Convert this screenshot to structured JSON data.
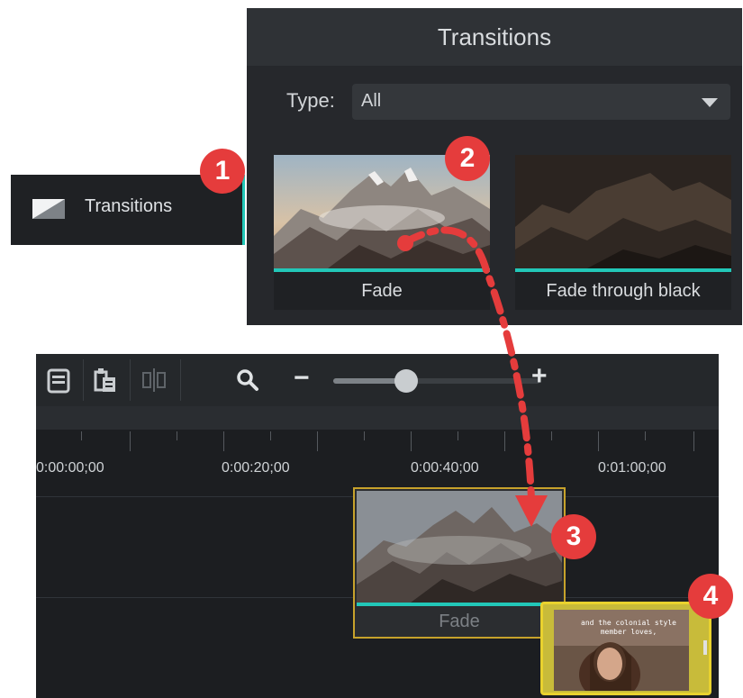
{
  "sidebar": {
    "label": "Transitions",
    "icon": "transitions-icon"
  },
  "panel": {
    "title": "Transitions",
    "type_label": "Type:",
    "type_value": "All",
    "tiles": [
      {
        "label": "Fade"
      },
      {
        "label": "Fade through black"
      }
    ]
  },
  "timeline": {
    "toolbar": {
      "zoom_minus": "−",
      "zoom_plus": "+",
      "zoom_level": 0.35
    },
    "ruler_labels": [
      "0:00:00;00",
      "0:00:20;00",
      "0:00:40;00",
      "0:01:00;00"
    ],
    "clip_fade_label": "Fade",
    "video_caption": "and the colonial style\nmember loves,"
  },
  "badges": [
    "1",
    "2",
    "3",
    "4"
  ],
  "colors": {
    "accent_teal": "#22c7b8",
    "badge_red": "#e53c3c",
    "clip_gold": "#c7a22b",
    "video_yellow": "#e9d22e"
  }
}
